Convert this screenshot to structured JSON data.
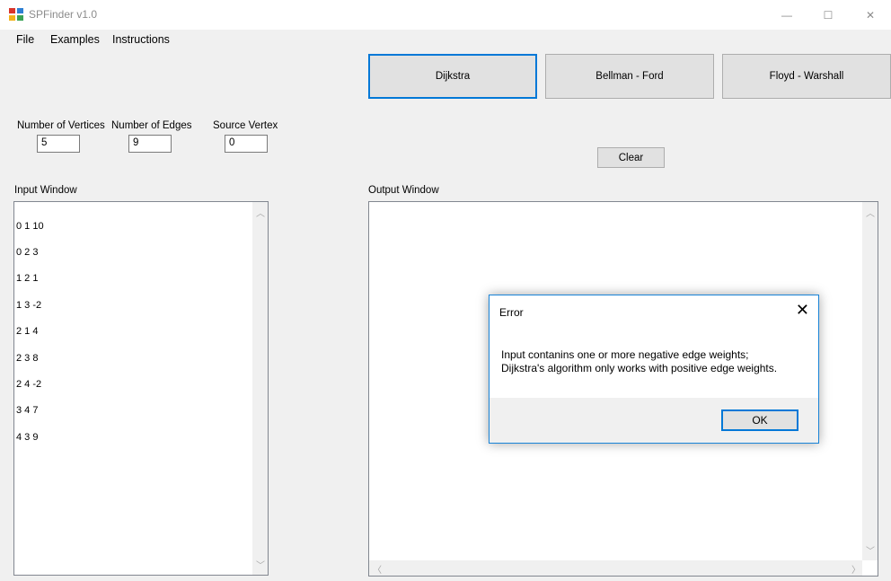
{
  "window": {
    "title": "SPFinder v1.0",
    "minimize_glyph": "—",
    "maximize_glyph": "☐",
    "close_glyph": "✕"
  },
  "menu": [
    "File",
    "Examples",
    "Instructions"
  ],
  "algorithms": {
    "dijkstra": "Dijkstra",
    "bellman_ford": "Bellman - Ford",
    "floyd_warshall": "Floyd - Warshall"
  },
  "params": {
    "vertices_label": "Number of Vertices",
    "vertices_value": "5",
    "edges_label": "Number of Edges",
    "edges_value": "9",
    "source_label": "Source Vertex",
    "source_value": "0"
  },
  "clear_label": "Clear",
  "input_window": {
    "label": "Input Window",
    "lines": [
      "0 1 10",
      "0 2 3",
      "1 2 1",
      "1 3 -2",
      "2 1 4",
      "2 3 8",
      "2 4 -2",
      "3 4 7",
      "4 3 9"
    ]
  },
  "output_window": {
    "label": "Output Window"
  },
  "error_dialog": {
    "title": "Error",
    "close_glyph": "✕",
    "message_line1": "Input contanins one or more negative edge weights;",
    "message_line2": "Dijkstra's algorithm only works with positive edge weights.",
    "ok_label": "OK"
  },
  "scroll_arrows": {
    "up": "︿",
    "down": "﹀",
    "left": "〈",
    "right": "〉"
  },
  "colors": {
    "accent": "#0078d7",
    "button_face": "#e1e1e1",
    "background": "#f0f0f0"
  }
}
